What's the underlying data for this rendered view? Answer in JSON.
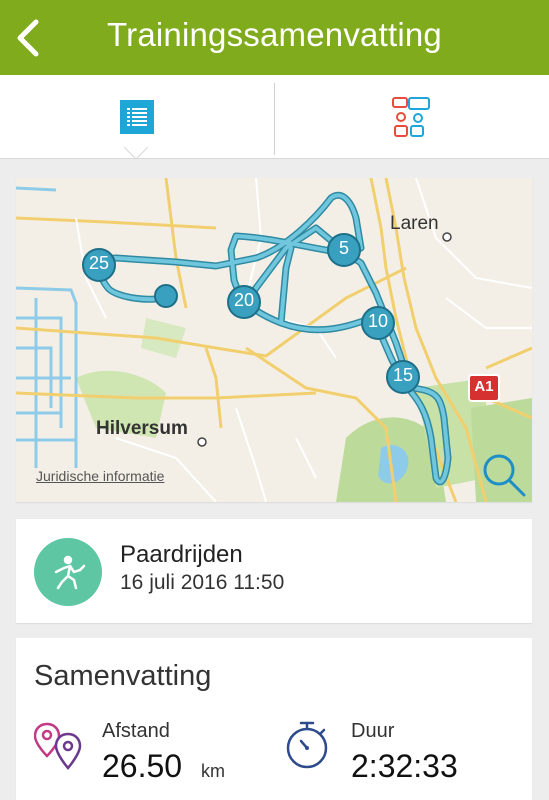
{
  "header": {
    "title": "Trainingssamenvatting",
    "back_icon": "chevron-left-icon",
    "background": "#7fab1c"
  },
  "tabs": [
    {
      "id": "summary",
      "icon": "list-icon",
      "selected": true,
      "color": "#1ea7d6"
    },
    {
      "id": "laps",
      "icon": "lap-flow-icon",
      "selected": false,
      "color": "#e74c3c"
    }
  ],
  "map": {
    "places": [
      "Laren",
      "Hilversum"
    ],
    "road_sign": "A1",
    "km_markers": [
      "25",
      "20",
      "5",
      "10",
      "15"
    ],
    "legal_link": "Juridische informatie",
    "zoom_icon": "magnifier-icon",
    "route_color": "#56b6cf"
  },
  "activity": {
    "sport": "Paardrijden",
    "date": "16 juli 2016 11:50",
    "icon": "horse-riding-icon",
    "icon_color": "#5fc6a3"
  },
  "summary": {
    "title": "Samenvatting",
    "distance": {
      "label": "Afstand",
      "value": "26.50",
      "unit": "km",
      "icon": "location-pins-icon"
    },
    "duration": {
      "label": "Duur",
      "value": "2:32:33",
      "icon": "stopwatch-icon"
    }
  }
}
